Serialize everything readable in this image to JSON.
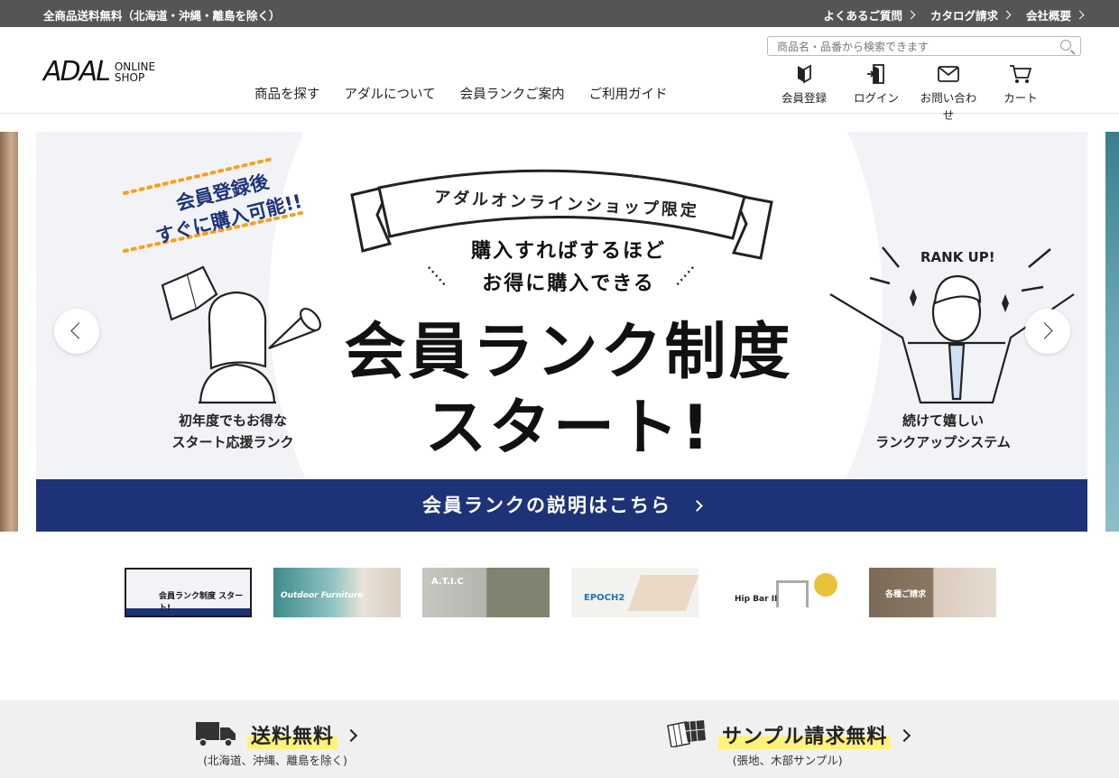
{
  "topbar": {
    "promo": "全商品送料無料（北海道・沖縄・離島を除く）",
    "links": [
      "よくあるご質問",
      "カタログ請求",
      "会社概要"
    ]
  },
  "header": {
    "logo": {
      "mark": "ADAL",
      "sub1": "ONLINE",
      "sub2": "SHOP"
    },
    "nav": [
      "商品を探す",
      "アダルについて",
      "会員ランクご案内",
      "ご利用ガイド"
    ],
    "search": {
      "placeholder": "商品名・品番から検索できます"
    },
    "icons": [
      {
        "label": "会員登録",
        "icon": "beginner-mark-icon"
      },
      {
        "label": "ログイン",
        "icon": "login-door-icon"
      },
      {
        "label": "お問い合わせ",
        "icon": "mail-icon"
      },
      {
        "label": "カート",
        "icon": "cart-icon"
      }
    ]
  },
  "banner": {
    "badge_line1": "会員登録後",
    "badge_line2": "すぐに購入可能!!",
    "ribbon": "アダルオンラインショップ限定",
    "sub1": "購入すればするほど",
    "sub2": "お得に購入できる",
    "main1": "会員ランク制度",
    "main2": "スタート!",
    "left_caption_1": "初年度でもお得な",
    "left_caption_2": "スタート応援ランク",
    "rankup": "RANK UP!",
    "right_caption_1": "続けて嬉しい",
    "right_caption_2": "ランクアップシステム",
    "cta": "会員ランクの説明はこちら"
  },
  "thumbnails": [
    {
      "label": "会員ランク制度 スタート!",
      "active": true
    },
    {
      "label": "Outdoor Furniture",
      "active": false
    },
    {
      "label": "A.T.I.C",
      "active": false
    },
    {
      "label": "EPOCH2",
      "active": false
    },
    {
      "label": "Hip Bar II",
      "active": false
    },
    {
      "label": "各種ご請求",
      "active": false
    }
  ],
  "benefits": [
    {
      "title": "送料無料",
      "note": "(北海道、沖縄、離島を除く)",
      "icon": "truck-icon"
    },
    {
      "title": "サンプル請求無料",
      "note": "(張地、木部サンプル)",
      "icon": "sample-swatch-icon"
    }
  ],
  "colors": {
    "topbar": "#555555",
    "navy": "#1e3377",
    "highlight": "#fff27a",
    "badge": "#1e3377",
    "dots": "#f5a01e"
  }
}
